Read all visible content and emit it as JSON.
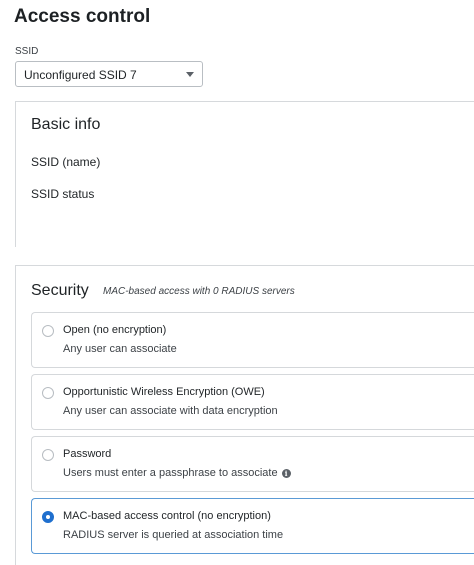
{
  "page": {
    "title": "Access control"
  },
  "ssid_selector": {
    "label": "SSID",
    "selected_value": "Unconfigured SSID 7"
  },
  "basic_info": {
    "title": "Basic info",
    "fields": [
      "SSID (name)",
      "SSID status"
    ]
  },
  "security": {
    "title": "Security",
    "subtitle": "MAC-based access with 0 RADIUS servers",
    "options": [
      {
        "title": "Open (no encryption)",
        "description": "Any user can associate",
        "selected": false,
        "info_icon": false
      },
      {
        "title": "Opportunistic Wireless Encryption (OWE)",
        "description": "Any user can associate with data encryption",
        "selected": false,
        "info_icon": false
      },
      {
        "title": "Password",
        "description": "Users must enter a passphrase to associate",
        "selected": false,
        "info_icon": true
      },
      {
        "title": "MAC-based access control (no encryption)",
        "description": "RADIUS server is queried at association time",
        "selected": true,
        "info_icon": false
      }
    ]
  },
  "colors": {
    "accent": "#1f6fce",
    "selected_border": "#5a9ad6",
    "divider": "#d6d9dc"
  }
}
